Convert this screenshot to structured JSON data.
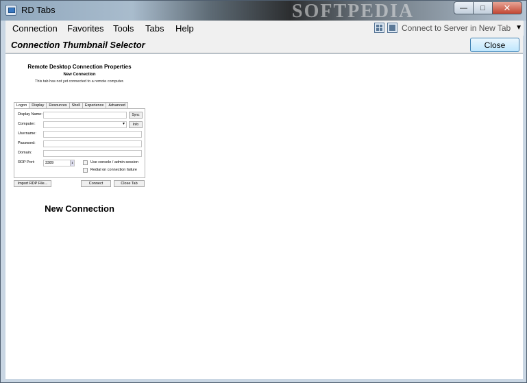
{
  "window": {
    "title": "RD Tabs",
    "brand_watermark": "SOFTPEDIA",
    "minimize_glyph": "—",
    "maximize_glyph": "□",
    "close_glyph": "✕"
  },
  "menu": {
    "items": [
      "Connection",
      "Favorites",
      "Tools",
      "Tabs",
      "Help"
    ],
    "connect_dropdown": "Connect to Server in New Tab",
    "dropdown_arrow": "▼"
  },
  "selector": {
    "title": "Connection Thumbnail Selector",
    "close_label": "Close"
  },
  "thumbnail": {
    "heading": "Remote Desktop Connection Properties",
    "subheading": "New Connection",
    "note": "This tab has not yet connected to a remote computer.",
    "tabs": [
      "Logon",
      "Display",
      "Resources",
      "Shell",
      "Experience",
      "Advanced"
    ],
    "fields": {
      "display_name": "Display Name:",
      "computer": "Computer:",
      "username": "Username:",
      "password": "Password:",
      "domain": "Domain:",
      "rdp_port": "RDP Port:"
    },
    "port_value": "3389",
    "sync_label": "Sync",
    "info_label": "Info",
    "use_console": "Use console / admin session",
    "redial": "Redial on connection failure",
    "import_label": "Import RDP File...",
    "connect_label": "Connect",
    "close_tab_label": "Close Tab",
    "name": "New Connection"
  }
}
